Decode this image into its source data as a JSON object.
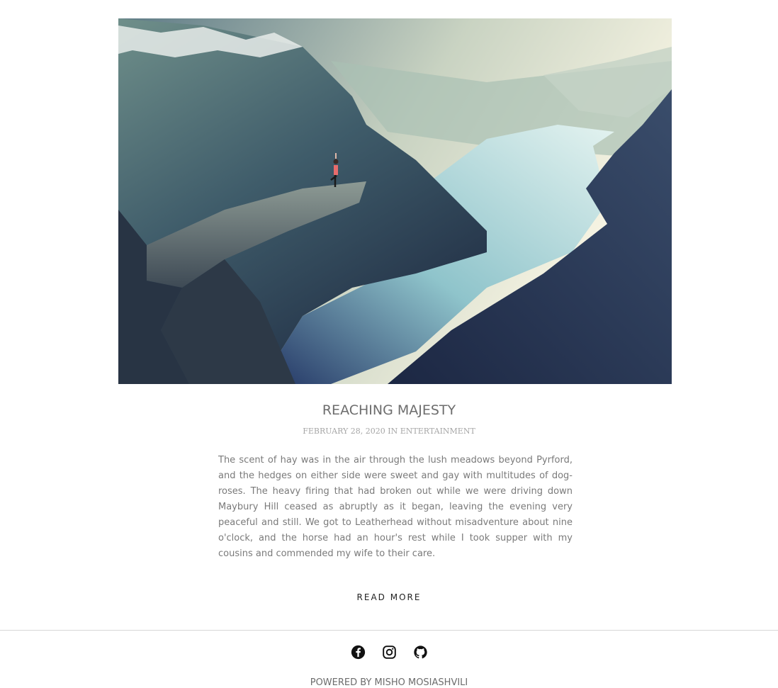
{
  "post": {
    "title": "REACHING MAJESTY",
    "date": "FEBRUARY 28, 2020",
    "category_prefix": "IN",
    "category": "ENTERTAINMENT",
    "excerpt": "The scent of hay was in the air through the lush meadows beyond Pyrford, and the hedges on either side were sweet and gay with multitudes of dog-roses. The heavy firing that had broken out while we were driving down Maybury Hill ceased as abruptly as it began, leaving the evening very peaceful and still. We got to Leatherhead without misadventure about nine o'clock, and the horse had an hour's rest while I took supper with my cousins and commended my wife to their care.",
    "read_more": "READ MORE"
  },
  "footer": {
    "social_icons": [
      "facebook-icon",
      "instagram-icon",
      "github-icon"
    ],
    "credit": "POWERED BY MISHO MOSIASHVILI"
  }
}
